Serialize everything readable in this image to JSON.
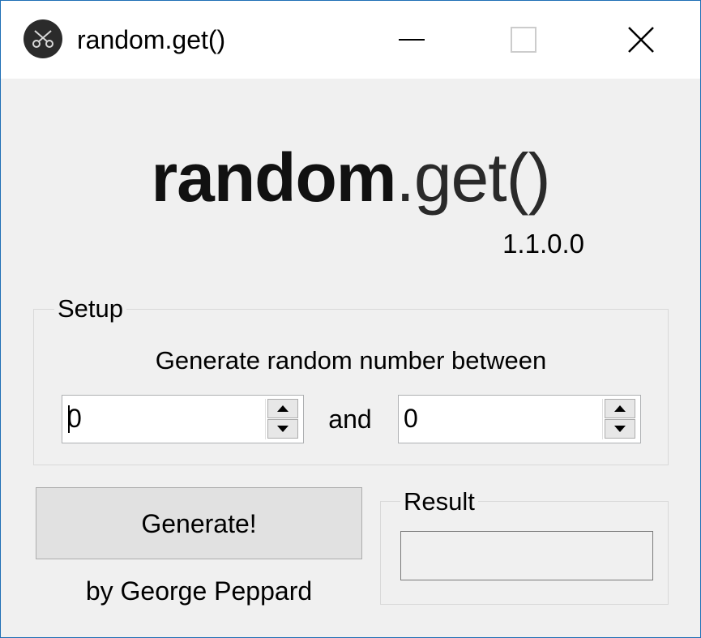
{
  "window": {
    "title": "random.get()",
    "app_icon": "scissors-icon",
    "controls": [
      "minimize-icon",
      "maximize-icon",
      "close-icon"
    ]
  },
  "header": {
    "logo_bold": "random",
    "logo_light": ".get()",
    "version": "1.1.0.0"
  },
  "setup": {
    "legend": "Setup",
    "caption": "Generate random number between",
    "min_value": "0",
    "and_label": "and",
    "max_value": "0"
  },
  "actions": {
    "generate_label": "Generate!",
    "byline": "by George Peppard"
  },
  "result": {
    "legend": "Result",
    "value": ""
  },
  "colors": {
    "window_border": "#1f6fb5",
    "window_background": "#f0f0f0",
    "title_background": "#ffffff",
    "button_background": "#e1e1e1"
  }
}
